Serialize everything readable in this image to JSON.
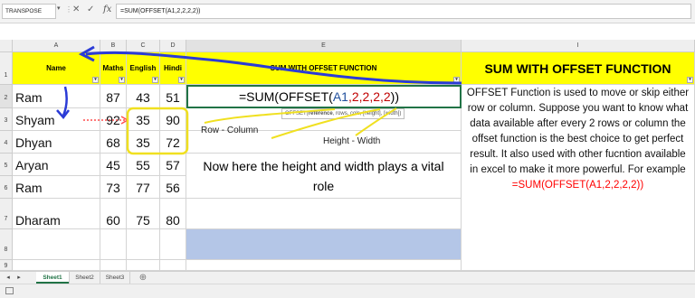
{
  "formula_bar": {
    "name_box": "TRANSPOSE",
    "cancel_icon": "✕",
    "enter_icon": "✓",
    "fx_label": "fx",
    "formula": "=SUM(OFFSET(A1,2,2,2,2))"
  },
  "columns": [
    "A",
    "B",
    "C",
    "D",
    "E",
    "I"
  ],
  "rows": [
    "1",
    "2",
    "3",
    "4",
    "5",
    "6",
    "7",
    "8",
    "9"
  ],
  "headers": {
    "name": "Name",
    "maths": "Maths",
    "english": "English",
    "hindi": "Hindi",
    "e_title": "SUM WITH OFFSET FUNCTION",
    "i_title": "SUM WITH OFFSET FUNCTION"
  },
  "table_rows": [
    {
      "name": "Ram",
      "maths": "87",
      "english": "43",
      "hindi": "51"
    },
    {
      "name": "Shyam",
      "maths": "92",
      "english": "35",
      "hindi": "90"
    },
    {
      "name": "Dhyan",
      "maths": "68",
      "english": "35",
      "hindi": "72"
    },
    {
      "name": "Aryan",
      "maths": "45",
      "english": "55",
      "hindi": "57"
    },
    {
      "name": "Ram",
      "maths": "73",
      "english": "77",
      "hindi": "56"
    },
    {
      "name": "Dharam",
      "maths": "60",
      "english": "75",
      "hindi": "80"
    }
  ],
  "formula_cell": {
    "prefix": "=SUM(OFFSET(",
    "ref": "A1",
    "args": ",2,2,2,2",
    "close": "))"
  },
  "tooltip": {
    "fn": "OFFSET(",
    "active": "reference",
    "rest": ", rows, cols, [height], [width])"
  },
  "annotations": {
    "row_col": "Row  - Column",
    "height_width": "Height  - Width",
    "note": "Now here the height and width plays a vital role"
  },
  "description": {
    "text": "OFFSET Function is used to move or skip either row or column. Suppose you want to know what data available after every 2 rows or column the offset function is the best choice to get perfect result. It also used with other fucntion available in excel to make it more powerful. For example",
    "example": "=SUM(OFFSET(A1,2,2,2,2))"
  },
  "sheet_tabs": [
    "Sheet1",
    "Sheet2",
    "Sheet3"
  ],
  "colors": {
    "header_yellow": "#ffff00",
    "active_tab_green": "#217346",
    "highlight_blue": "#b4c6e7",
    "example_red": "#ff0000"
  }
}
